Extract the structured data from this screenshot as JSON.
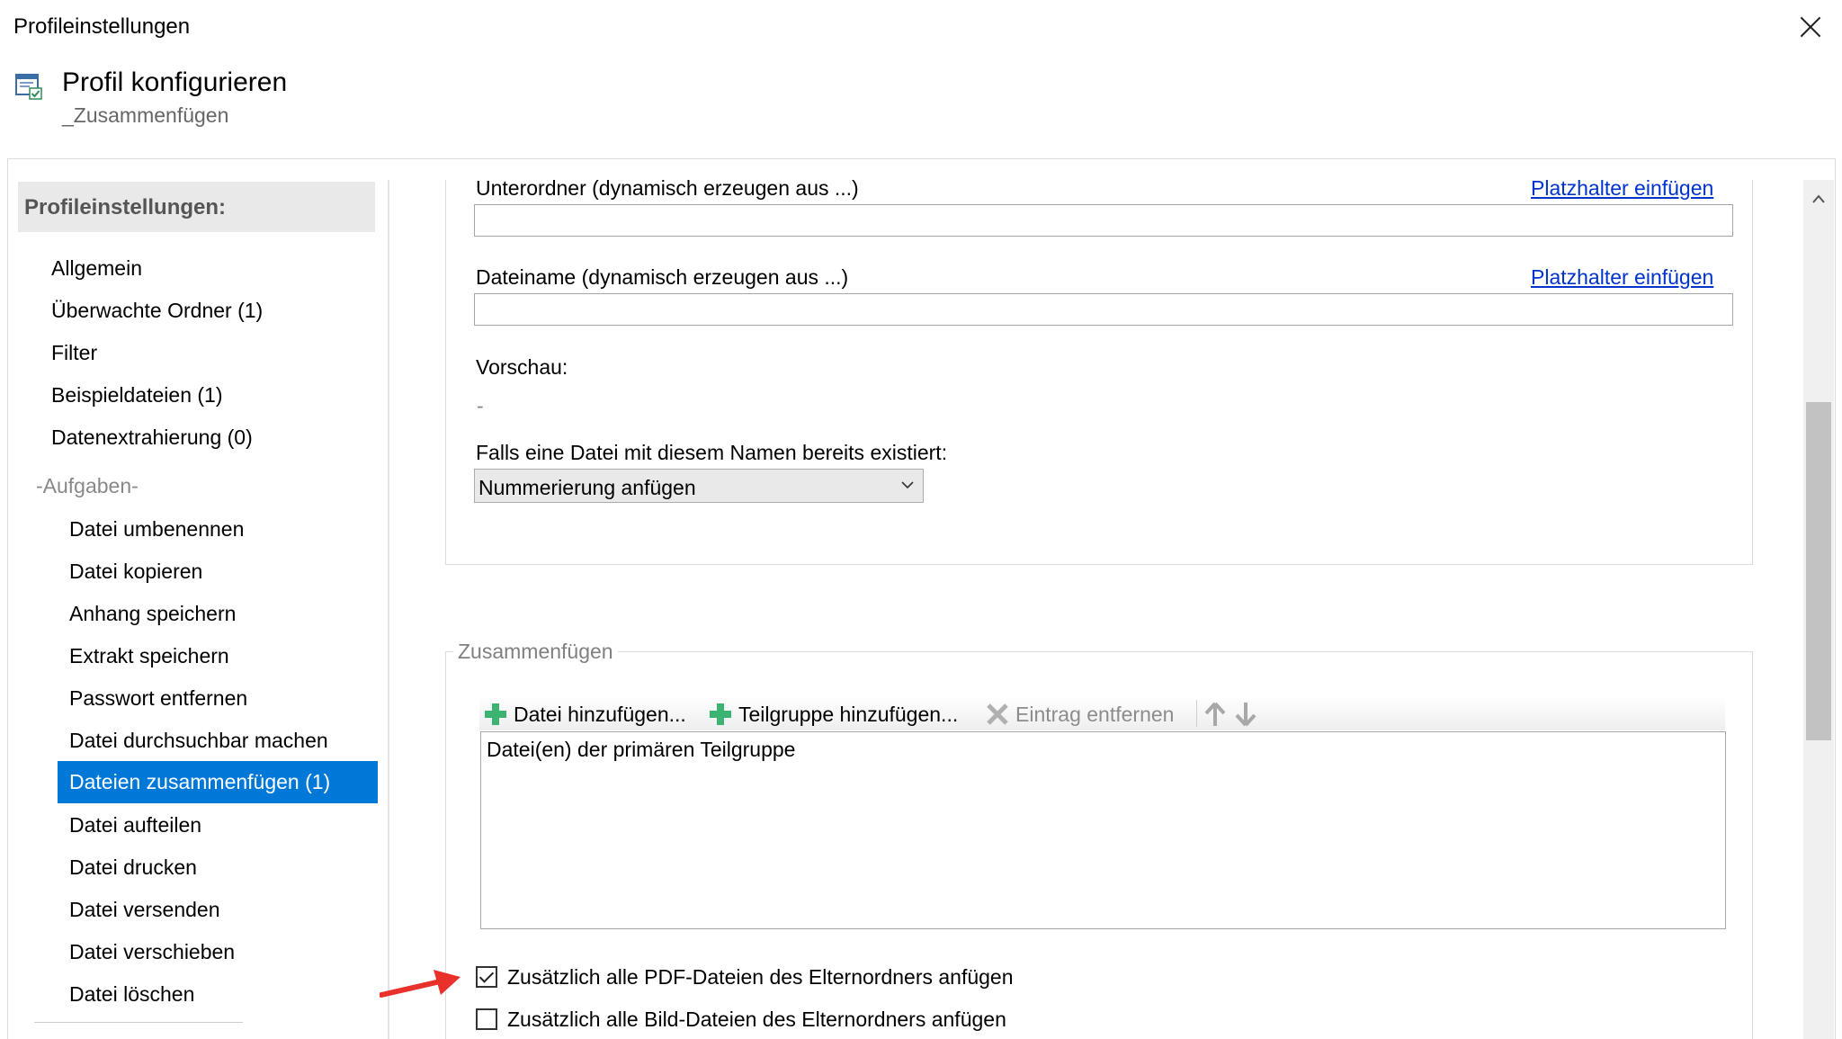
{
  "window": {
    "title": "Profileinstellungen"
  },
  "header": {
    "title": "Profil konfigurieren",
    "subtitle": "_Zusammenfügen"
  },
  "sidebar": {
    "heading": "Profileinstellungen:",
    "items": [
      {
        "label": "Allgemein"
      },
      {
        "label": "Überwachte Ordner (1)"
      },
      {
        "label": "Filter"
      },
      {
        "label": "Beispieldateien (1)"
      },
      {
        "label": "Datenextrahierung (0)"
      }
    ],
    "section_label": "-Aufgaben-",
    "tasks": [
      {
        "label": "Datei umbenennen"
      },
      {
        "label": "Datei kopieren"
      },
      {
        "label": "Anhang speichern"
      },
      {
        "label": "Extrakt speichern"
      },
      {
        "label": "Passwort entfernen"
      },
      {
        "label": "Datei durchsuchbar machen"
      },
      {
        "label": "Dateien zusammenfügen (1)"
      },
      {
        "label": "Datei aufteilen"
      },
      {
        "label": "Datei drucken"
      },
      {
        "label": "Datei versenden"
      },
      {
        "label": "Datei verschieben"
      },
      {
        "label": "Datei löschen"
      }
    ],
    "selected_task": "Dateien zusammenfügen (1)"
  },
  "main": {
    "subfolder": {
      "label": "Unterordner (dynamisch erzeugen aus ...)",
      "link": "Platzhalter einfügen",
      "value": ""
    },
    "filename": {
      "label": "Dateiname (dynamisch erzeugen aus ...)",
      "link": "Platzhalter einfügen",
      "value": ""
    },
    "preview": {
      "label": "Vorschau:",
      "value": "-"
    },
    "exists": {
      "label": "Falls eine Datei mit diesem Namen bereits existiert:",
      "selected": "Nummerierung anfügen"
    },
    "merge": {
      "group_label": "Zusammenfügen",
      "toolbar": {
        "add_file": "Datei hinzufügen...",
        "add_subgroup": "Teilgruppe hinzufügen...",
        "remove": "Eintrag entfernen"
      },
      "list_items": [
        "Datei(en) der primären Teilgruppe"
      ],
      "checkbox_pdf": {
        "label": "Zusätzlich alle PDF-Dateien des Elternordners anfügen",
        "checked": true
      },
      "checkbox_images": {
        "label": "Zusätzlich alle Bild-Dateien des Elternordners anfügen",
        "checked": false
      }
    }
  },
  "colors": {
    "accent": "#0078d7",
    "link": "#0033cc",
    "add_icon": "#3cb371",
    "annotation_arrow": "#e8312a"
  },
  "icons": {
    "close": "close-icon",
    "header": "settings-window-icon",
    "add": "plus-icon",
    "remove": "x-icon",
    "move_up": "arrow-up-icon",
    "move_down": "arrow-down-icon",
    "dropdown": "chevron-down-icon",
    "scroll_up": "chevron-up-icon"
  }
}
